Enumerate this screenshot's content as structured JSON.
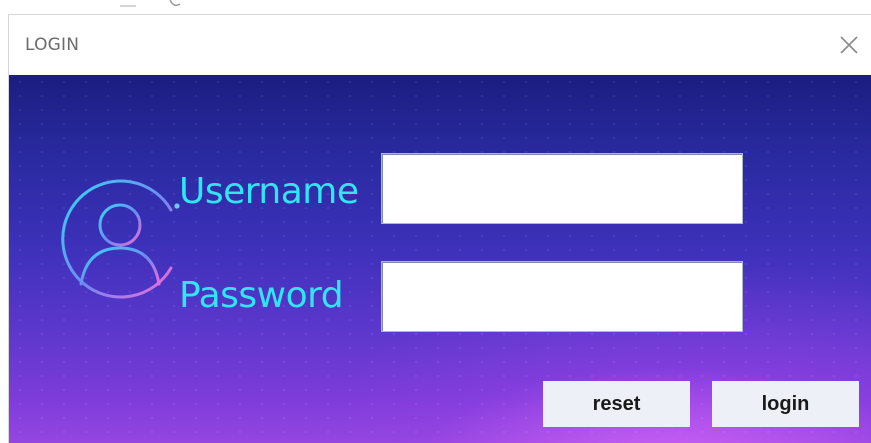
{
  "window": {
    "title": "LOGIN"
  },
  "form": {
    "username_label": "Username",
    "password_label": "Password",
    "username_value": "",
    "password_value": ""
  },
  "buttons": {
    "reset": "reset",
    "login": "login"
  },
  "icons": {
    "close": "close-icon",
    "avatar": "user-avatar-icon"
  },
  "colors": {
    "label": "#2fe6f4",
    "button_bg": "#edf1f7",
    "panel_top": "#1b1d80",
    "panel_bottom": "#9546e0"
  }
}
